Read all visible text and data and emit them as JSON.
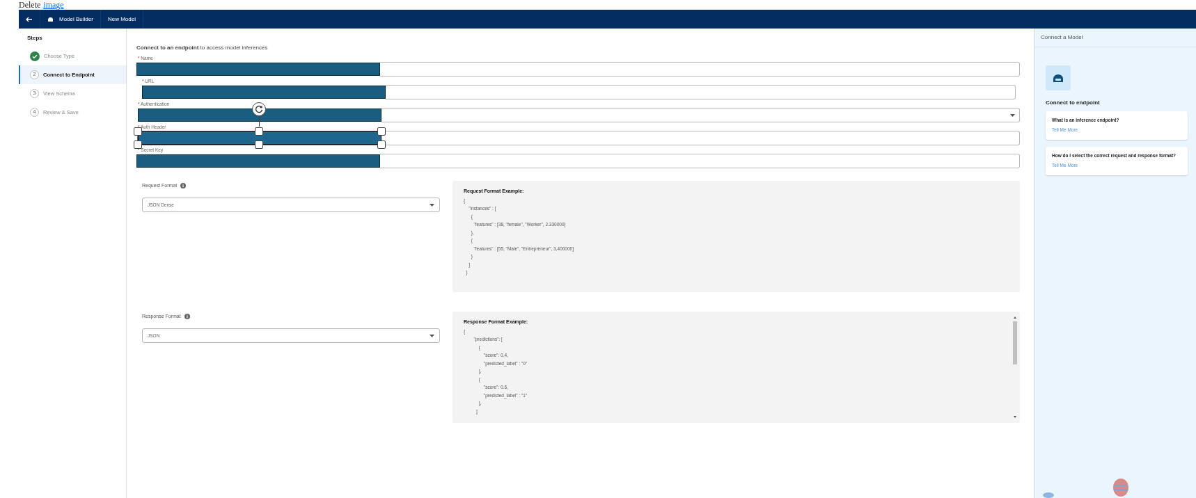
{
  "page_header": {
    "text": "Delete",
    "link": "image"
  },
  "top_bar": {
    "breadcrumbs": [
      "Model Builder",
      "New Model"
    ]
  },
  "steps": {
    "title": "Steps",
    "items": [
      {
        "label": "Choose Type",
        "completed": true,
        "selected": false
      },
      {
        "number": "2",
        "label": "Connect to Endpoint",
        "completed": false,
        "selected": true
      },
      {
        "number": "3",
        "label": "View Schema",
        "completed": false,
        "selected": false
      },
      {
        "number": "4",
        "label": "Review & Save",
        "completed": false,
        "selected": false
      }
    ]
  },
  "form": {
    "heading": "**Connect to an endpoint** to access model inferences",
    "fields": [
      {
        "label": "Name",
        "kind": "text",
        "required_mark": "*",
        "selected": false
      },
      {
        "label": "URL",
        "kind": "text",
        "required_mark": "*",
        "selected": false
      },
      {
        "label": "Authentication",
        "kind": "select",
        "required_mark": "*",
        "selected": false
      },
      {
        "label": "Auth Header",
        "kind": "text",
        "required_mark": "*",
        "selected": true
      },
      {
        "label": "Secret Key",
        "kind": "text",
        "required_mark": "*",
        "selected": false
      }
    ],
    "formats": [
      {
        "label": "Request Format",
        "value": "JSON Dense",
        "example_title": "Request Format Example:",
        "scrollable": false,
        "lines": [
          "{",
          "    \"instances\" : [",
          "      {",
          "        \"features\" : [38, \"female\", \"Worker\", 2.330000]",
          "      },",
          "      {",
          "        \"features\" : [55, \"Male\", \"Entrepreneur\", 3,400000]",
          "      }",
          "    ]",
          "  }"
        ]
      },
      {
        "label": "Response Format",
        "value": "JSON",
        "example_title": "Response Format Example:",
        "scrollable": true,
        "lines": [
          "{",
          "        \"predictions\": [",
          "            {",
          "                \"score\": 0.4,",
          "                \"predicted_label\" : \"0\"",
          "            },",
          "            {",
          "                \"score\": 0.6,",
          "                \"predicted_label\" : \"1\"",
          "            },",
          "          ]"
        ]
      }
    ]
  },
  "side_panel": {
    "title": "Connect a Model",
    "heading": "Connect to endpoint",
    "cards": [
      {
        "question": "What is an inference endpoint?",
        "link": "Tell Me More"
      },
      {
        "question": "How do I select the correct request and response format?",
        "link": "Tell Me More"
      }
    ]
  }
}
